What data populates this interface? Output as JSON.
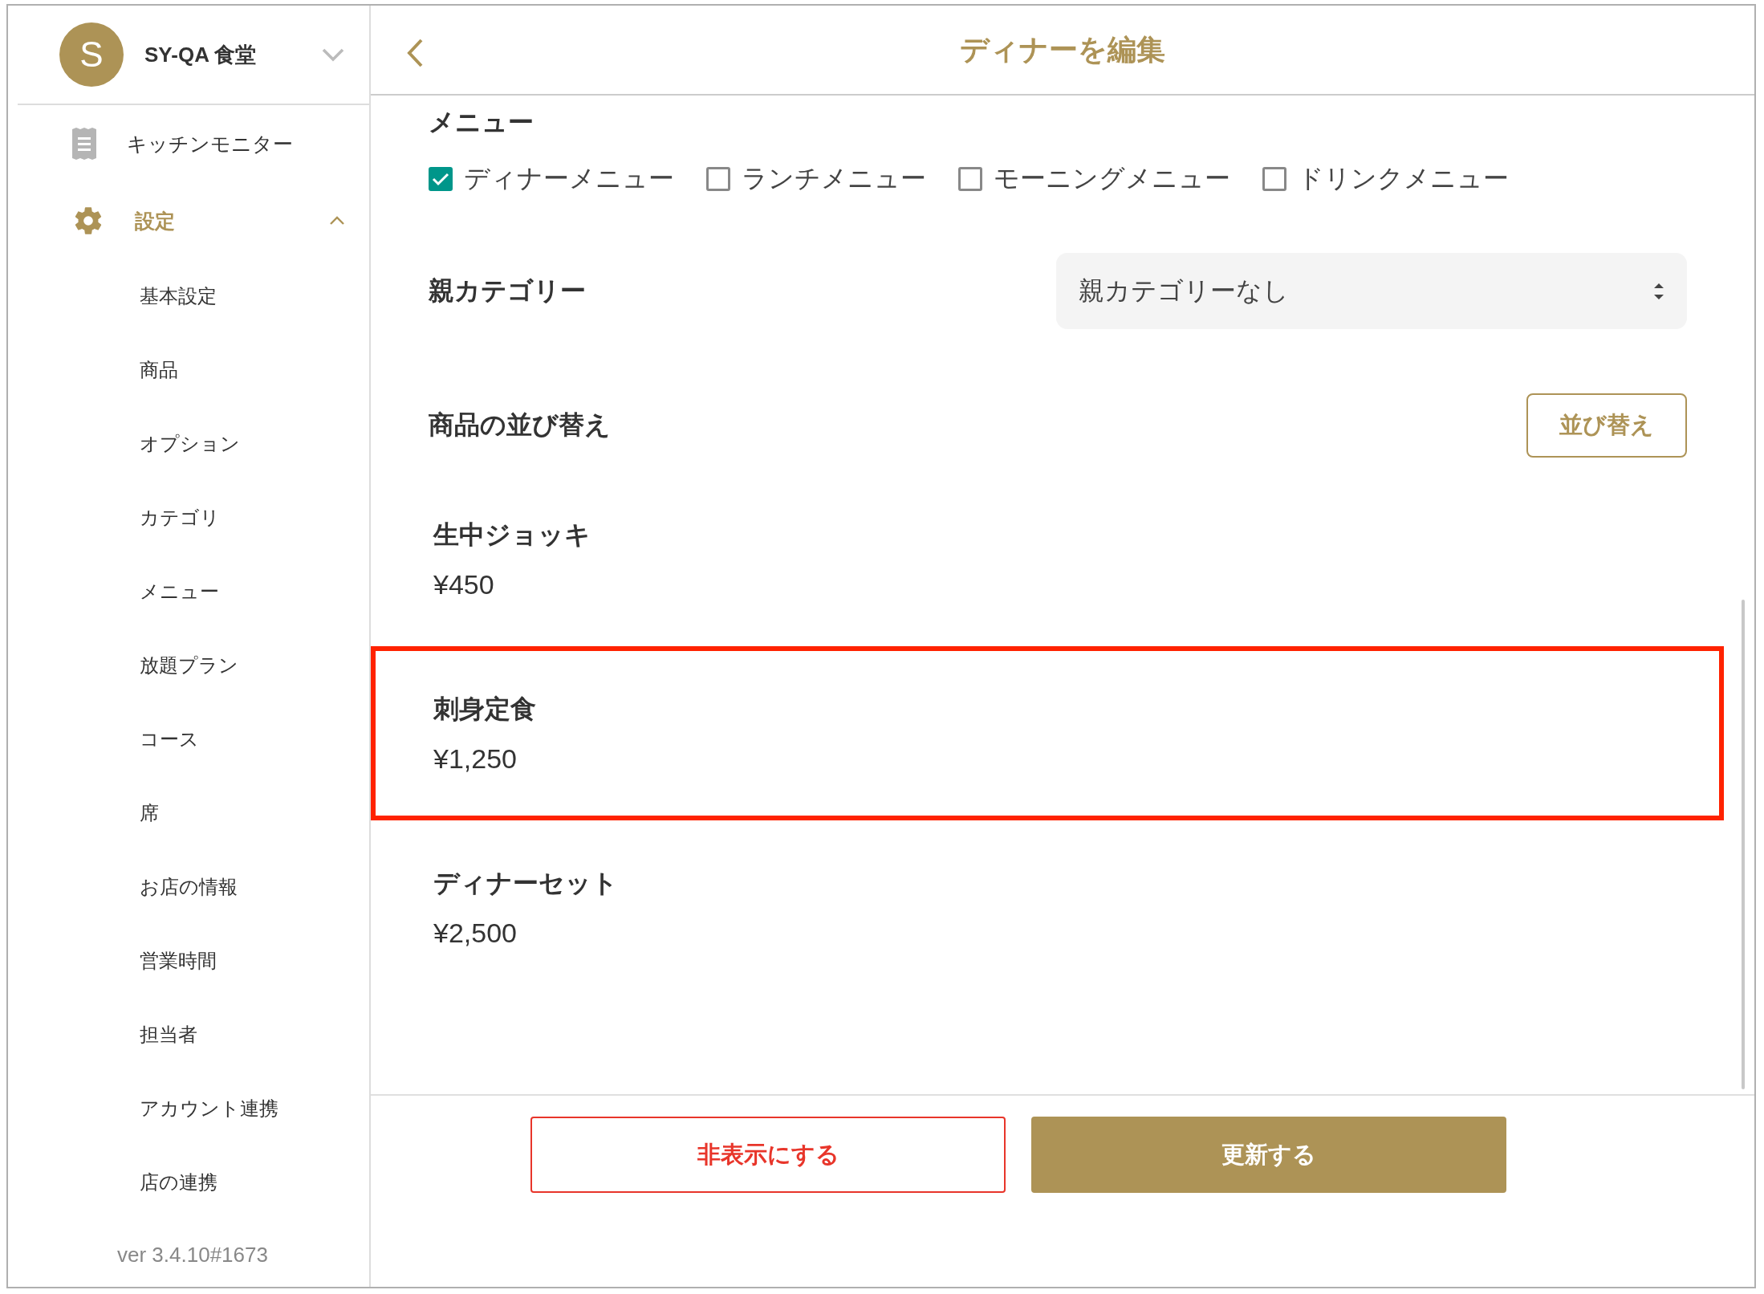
{
  "sidebar": {
    "shop": {
      "avatar": "S",
      "name": "SY-QA 食堂"
    },
    "items": [
      {
        "label": "キッチンモニター",
        "kind": "receipt",
        "selected": false
      },
      {
        "label": "設定",
        "kind": "gear",
        "selected": true,
        "expanded": true,
        "children": [
          {
            "label": "基本設定",
            "selected": false
          },
          {
            "label": "商品",
            "selected": false
          },
          {
            "label": "オプション",
            "selected": false
          },
          {
            "label": "カテゴリ",
            "selected": false
          },
          {
            "label": "メニュー",
            "selected": false
          },
          {
            "label": "放題プラン",
            "selected": false
          },
          {
            "label": "コース",
            "selected": false
          },
          {
            "label": "席",
            "selected": false
          },
          {
            "label": "お店の情報",
            "selected": false
          },
          {
            "label": "営業時間",
            "selected": false
          },
          {
            "label": "担当者",
            "selected": false
          },
          {
            "label": "アカウント連携",
            "selected": false
          },
          {
            "label": "店の連携",
            "selected": false
          }
        ]
      }
    ],
    "version": "ver 3.4.10#1673"
  },
  "header": {
    "title": "ディナーを編集"
  },
  "menu_section": {
    "label": "メニュー",
    "options": [
      {
        "label": "ディナーメニュー",
        "checked": true
      },
      {
        "label": "ランチメニュー",
        "checked": false
      },
      {
        "label": "モーニングメニュー",
        "checked": false
      },
      {
        "label": "ドリンクメニュー",
        "checked": false
      }
    ]
  },
  "parent_category": {
    "label": "親カテゴリー",
    "value": "親カテゴリーなし"
  },
  "sort": {
    "label": "商品の並び替え",
    "button": "並び替え"
  },
  "products": [
    {
      "name": "生中ジョッキ",
      "price": "¥450",
      "highlighted": false
    },
    {
      "name": "刺身定食",
      "price": "¥1,250",
      "highlighted": true
    },
    {
      "name": "ディナーセット",
      "price": "¥2,500",
      "highlighted": false
    }
  ],
  "footer_buttons": [
    {
      "label": "非表示にする",
      "kind": "danger"
    },
    {
      "label": "更新する",
      "kind": "primary"
    }
  ]
}
